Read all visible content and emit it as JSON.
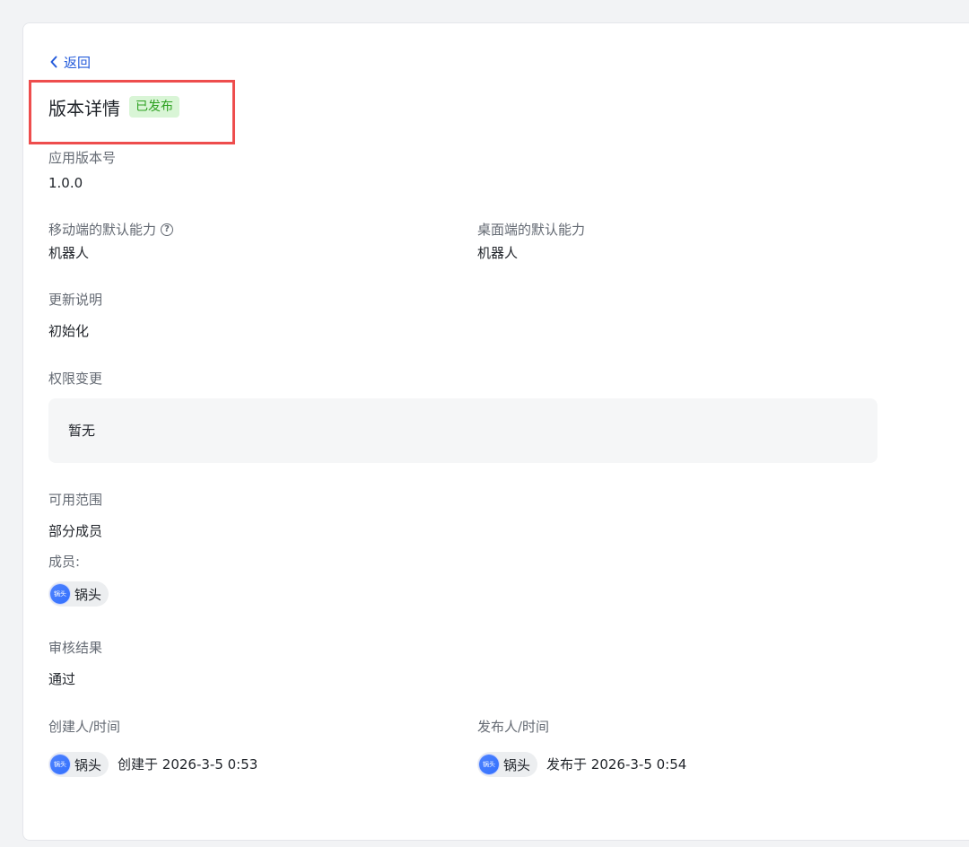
{
  "nav": {
    "back_label": "返回"
  },
  "header": {
    "title": "版本详情",
    "status": "已发布"
  },
  "version": {
    "label": "应用版本号",
    "value": "1.0.0"
  },
  "capabilities": {
    "mobile_label": "移动端的默认能力",
    "mobile_value": "机器人",
    "desktop_label": "桌面端的默认能力",
    "desktop_value": "机器人"
  },
  "release_notes": {
    "label": "更新说明",
    "value": "初始化"
  },
  "permissions": {
    "label": "权限变更",
    "value": "暂无"
  },
  "availability": {
    "label": "可用范围",
    "value": "部分成员",
    "members_label": "成员:",
    "members": [
      {
        "avatar_text": "锅头",
        "name": "锅头"
      }
    ]
  },
  "review": {
    "label": "审核结果",
    "value": "通过"
  },
  "creator": {
    "label": "创建人/时间",
    "avatar_text": "锅头",
    "name": "锅头",
    "time_text": "创建于 2026-3-5 0:53"
  },
  "publisher": {
    "label": "发布人/时间",
    "avatar_text": "锅头",
    "name": "锅头",
    "time_text": "发布于 2026-3-5 0:54"
  },
  "colors": {
    "link": "#245bdb",
    "badge_bg": "#d9f5d6",
    "badge_text": "#2ea121",
    "highlight_box": "#ee4d4d"
  },
  "icons": {
    "back": "chevron-left-icon",
    "help": "question-circle-icon"
  }
}
